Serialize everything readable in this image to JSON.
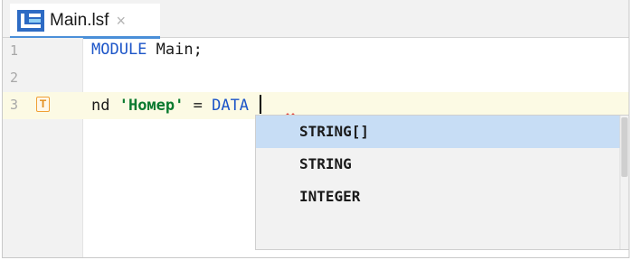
{
  "tab": {
    "title": "Main.lsf",
    "close": "×",
    "icon": "lsfusion-file-icon"
  },
  "editor": {
    "lines": [
      {
        "number": "1",
        "keyword": "MODULE",
        "rest": " Main;"
      },
      {
        "number": "2"
      },
      {
        "number": "3",
        "marker": "T",
        "ident": "nd ",
        "string": "'Номер'",
        "op": " = ",
        "keyword": "DATA",
        "trail": " "
      }
    ]
  },
  "completion": {
    "items": [
      "STRING[]",
      "STRING",
      "INTEGER"
    ],
    "selected_index": 0
  },
  "colors": {
    "keyword": "#1c55c8",
    "string": "#0a7a2f",
    "selection": "#c7ddf5",
    "current_line": "#fcfae4",
    "marker": "#f0a035"
  }
}
